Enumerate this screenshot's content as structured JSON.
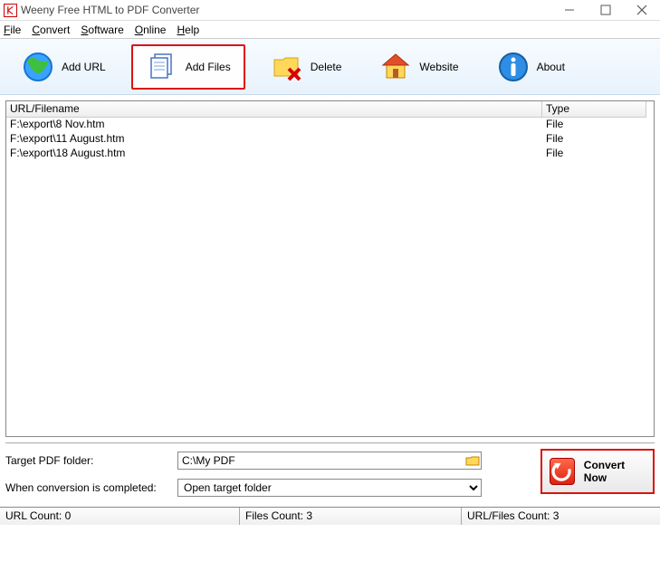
{
  "window": {
    "title": "Weeny Free HTML to PDF Converter"
  },
  "menu": {
    "file": "File",
    "convert": "Convert",
    "software": "Software",
    "online": "Online",
    "help": "Help"
  },
  "toolbar": {
    "add_url": "Add URL",
    "add_files": "Add Files",
    "delete": "Delete",
    "website": "Website",
    "about": "About"
  },
  "list": {
    "hdr_url": "URL/Filename",
    "hdr_type": "Type",
    "rows": [
      {
        "url": "F:\\export\\8 Nov.htm",
        "type": "File"
      },
      {
        "url": "F:\\export\\11 August.htm",
        "type": "File"
      },
      {
        "url": "F:\\export\\18 August.htm",
        "type": "File"
      }
    ]
  },
  "form": {
    "target_label": "Target PDF folder:",
    "target_value": "C:\\My PDF",
    "complete_label": "When conversion is completed:",
    "complete_value": "Open target folder"
  },
  "convert": {
    "label": "Convert Now"
  },
  "status": {
    "urls": "URL Count: 0",
    "files": "Files Count: 3",
    "total": "URL/Files Count: 3"
  }
}
